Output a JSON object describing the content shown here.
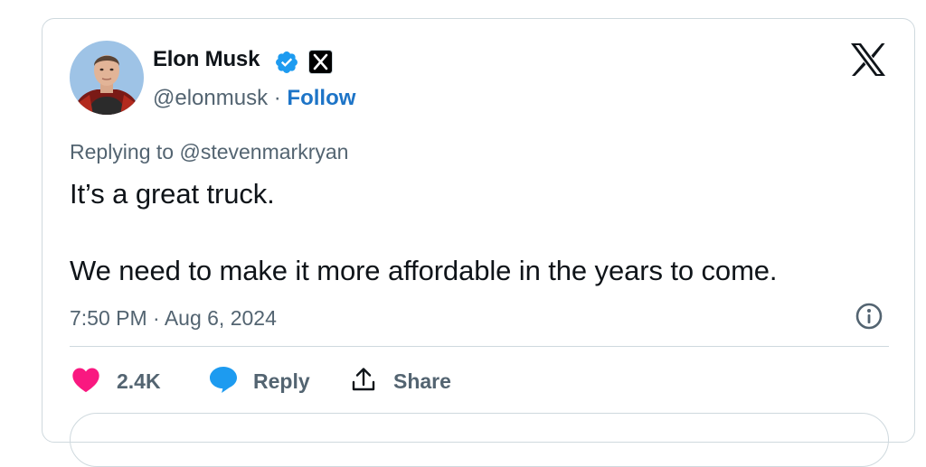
{
  "author": {
    "name": "Elon Musk",
    "handle": "@elonmusk",
    "separator": "·",
    "follow_label": "Follow"
  },
  "reply_context": {
    "prefix": "Replying to",
    "handle": "@stevenmarkryan"
  },
  "tweet": {
    "lines": [
      "It’s a great truck.",
      "We need to make it more affordable in the years to come."
    ],
    "timestamp": "7:50 PM · Aug 6, 2024"
  },
  "actions": {
    "like_count": "2.4K",
    "reply_label": "Reply",
    "share_label": "Share"
  },
  "icons": {
    "verified": "verified-badge-icon",
    "affiliation": "x-affiliation-badge-icon",
    "brand": "x-logo-icon",
    "info": "info-icon",
    "like": "heart-icon",
    "reply": "speech-bubble-icon",
    "share": "share-icon"
  },
  "colors": {
    "text": "#0f1419",
    "secondary_text": "#536471",
    "follow_link": "#1d74c7",
    "verified_badge": "#1d9bf0",
    "like_heart": "#f91880",
    "reply_bubble": "#1d9bf0",
    "border": "#cfd9de"
  }
}
